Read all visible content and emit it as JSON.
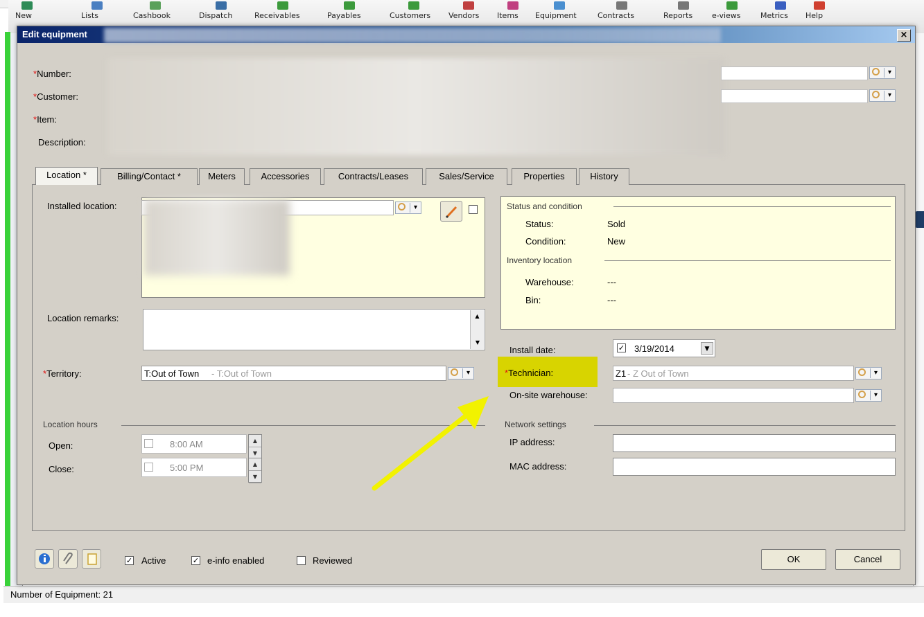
{
  "toolbar": {
    "items": [
      "New",
      "Lists",
      "Cashbook",
      "Dispatch",
      "Receivables",
      "Payables",
      "Customers",
      "Vendors",
      "Items",
      "Equipment",
      "Contracts",
      "Reports",
      "e-views",
      "Metrics",
      "Help"
    ]
  },
  "status_bar": {
    "text": "Number of Equipment: 21"
  },
  "dialog": {
    "title": "Edit equipment",
    "close_label": "×",
    "fields": {
      "number_label": "Number:",
      "customer_label": "Customer:",
      "item_label": "Item:",
      "description_label": "Description:"
    },
    "tabs": [
      "Location *",
      "Billing/Contact *",
      "Meters",
      "Accessories",
      "Contracts/Leases",
      "Sales/Service",
      "Properties",
      "History"
    ],
    "location": {
      "installed_location_label": "Installed location:",
      "location_remarks_label": "Location remarks:",
      "territory_label": "Territory:",
      "territory_code": "T:Out of Town",
      "territory_desc": " - T:Out of Town",
      "location_hours_title": "Location hours",
      "open_label": "Open:",
      "open_value": "8:00 AM",
      "close_label": "Close:",
      "close_value": "5:00 PM"
    },
    "status": {
      "group_title": "Status and condition",
      "status_label": "Status:",
      "status_value": "Sold",
      "condition_label": "Condition:",
      "condition_value": "New",
      "inventory_title": "Inventory location",
      "warehouse_label": "Warehouse:",
      "warehouse_value": "---",
      "bin_label": "Bin:",
      "bin_value": "---"
    },
    "install": {
      "install_date_label": "Install date:",
      "install_date_value": "3/19/2014",
      "technician_label": "Technician:",
      "technician_code": "Z1",
      "technician_desc": " - Z Out of Town",
      "onsite_label": "On-site warehouse:"
    },
    "network": {
      "title": "Network settings",
      "ip_label": "IP address:",
      "mac_label": "MAC address:"
    },
    "footer": {
      "active_label": "Active",
      "einfo_label": "e-info enabled",
      "reviewed_label": "Reviewed",
      "ok_label": "OK",
      "cancel_label": "Cancel",
      "active_checked": true,
      "einfo_checked": true,
      "reviewed_checked": false
    }
  },
  "colors": {
    "highlight": "#d8d400",
    "arrow": "#f2f200",
    "required": "#e01010",
    "cream_panel": "#ffffe1",
    "title_bar": "#0a246a"
  }
}
